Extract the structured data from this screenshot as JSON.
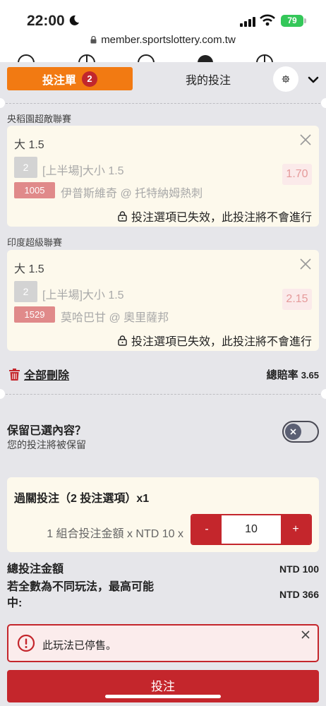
{
  "status_bar": {
    "time": "22:00",
    "battery": "79"
  },
  "browser": {
    "url": "member.sportslottery.com.tw"
  },
  "icons": {
    "moon": "moon-icon",
    "lock": "lock-icon",
    "settings": "gear-icon",
    "collapse": "chevron-down-icon",
    "close": "close-icon",
    "trash": "trash-icon",
    "alert": "alert-circle-icon"
  },
  "tabs": {
    "betslip_label": "投注單",
    "betslip_count": "2",
    "mybets_label": "我的投注"
  },
  "bets": [
    {
      "league": "央稻園超敵聯賽",
      "selection": "大 1.5",
      "number": "2",
      "bet_type": "[上半場]大小 1.5",
      "match_id": "1005",
      "match_name": "伊普斯維奇 @ 托特納姆熱刺",
      "odds": "1.70",
      "status": "投注選項已失效，此投注將不會進行"
    },
    {
      "league": "印度超級聯賽",
      "selection": "大 1.5",
      "number": "2",
      "bet_type": "[上半場]大小 1.5",
      "match_id": "1529",
      "match_name": "莫哈巴甘 @ 奧里薩邦",
      "odds": "2.15",
      "status": "投注選項已失效，此投注將不會進行"
    }
  ],
  "actions": {
    "delete_all": "全部刪除",
    "total_odds_label": "總賠率",
    "total_odds_value": "3.65"
  },
  "retain": {
    "title": "保留已選內容？",
    "subtitle": "您的投注將被保留",
    "enabled": false
  },
  "parlay": {
    "title": "過關投注（2 投注選項）x1",
    "stake_label": "1 組合投注金額 x NTD 10 x",
    "minus": "-",
    "plus": "+",
    "stake_value": "10"
  },
  "summary": {
    "total_label": "總投注金額",
    "total_value": "NTD 100",
    "max_win_line1": "若全數為不同玩法，最高可能",
    "max_win_line2": "中:",
    "max_win_value": "NTD 366"
  },
  "alert": {
    "message": "此玩法已停售。"
  },
  "submit": {
    "label": "投注"
  },
  "colors": {
    "accent_orange": "#f27a12",
    "brand_red": "#c4262c",
    "card_bg": "#fdf9ec",
    "page_bg": "#e6e6ea"
  }
}
